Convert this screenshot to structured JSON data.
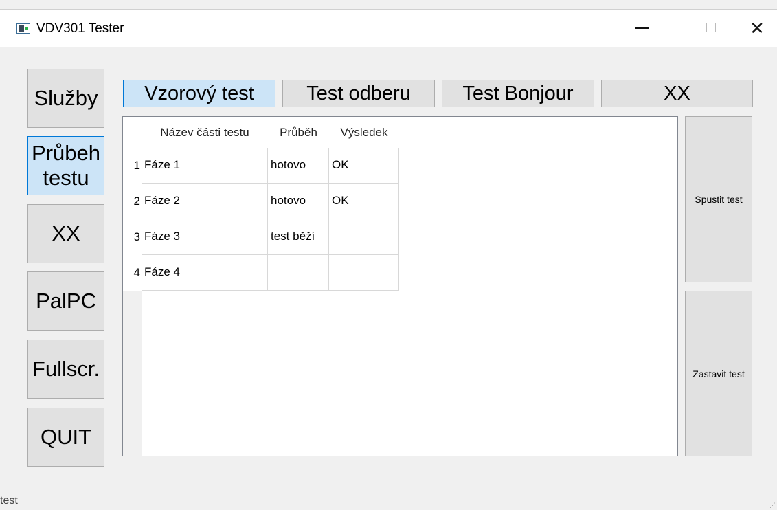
{
  "window": {
    "title": "VDV301 Tester",
    "controls": {
      "minimize": "—",
      "close": "✕"
    }
  },
  "sidebar": {
    "items": [
      {
        "label": "Služby",
        "active": false
      },
      {
        "label": "Průbeh testu",
        "active": true
      },
      {
        "label": "XX",
        "active": false
      },
      {
        "label": "PalPC",
        "active": false
      },
      {
        "label": "Fullscr.",
        "active": false
      },
      {
        "label": "QUIT",
        "active": false
      }
    ]
  },
  "tabs": [
    {
      "label": "Vzorový test",
      "active": true
    },
    {
      "label": "Test odberu",
      "active": false
    },
    {
      "label": "Test Bonjour",
      "active": false
    },
    {
      "label": "XX",
      "active": false
    }
  ],
  "table": {
    "columns": [
      "Název části testu",
      "Průběh",
      "Výsledek"
    ],
    "rows": [
      {
        "num": "1",
        "cells": [
          "Fáze 1",
          "hotovo",
          "OK"
        ]
      },
      {
        "num": "2",
        "cells": [
          "Fáze 2",
          "hotovo",
          "OK"
        ]
      },
      {
        "num": "3",
        "cells": [
          "Fáze 3",
          "test běží",
          ""
        ]
      },
      {
        "num": "4",
        "cells": [
          "Fáze 4",
          "",
          ""
        ]
      }
    ]
  },
  "actions": {
    "start": "Spustit test",
    "stop": "Zastavit test"
  },
  "status": {
    "text": "test"
  },
  "colors": {
    "active_fill": "#cce4f7",
    "active_border": "#0078d7",
    "button_fill": "#e1e1e1"
  }
}
